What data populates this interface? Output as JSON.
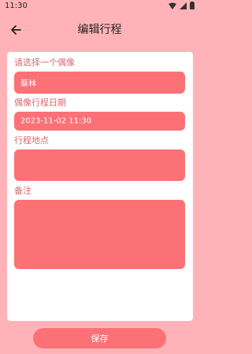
{
  "status_bar": {
    "time": "11:30",
    "icons": [
      "wifi-icon",
      "signal-icon",
      "battery-icon"
    ]
  },
  "header": {
    "title": "编辑行程",
    "back_icon": "arrow-left-icon"
  },
  "form": {
    "idol": {
      "label": "请选择一个偶像",
      "value": "蔡林"
    },
    "datetime": {
      "label": "偶像行程日期",
      "value": "2023-11-02 11:30"
    },
    "location": {
      "label": "行程地点",
      "value": ""
    },
    "notes": {
      "label": "备注",
      "value": ""
    }
  },
  "actions": {
    "save_label": "保存"
  },
  "colors": {
    "background": "#ffb3b8",
    "field": "#fb7176",
    "label": "#d86a71",
    "card": "#ffffff"
  }
}
